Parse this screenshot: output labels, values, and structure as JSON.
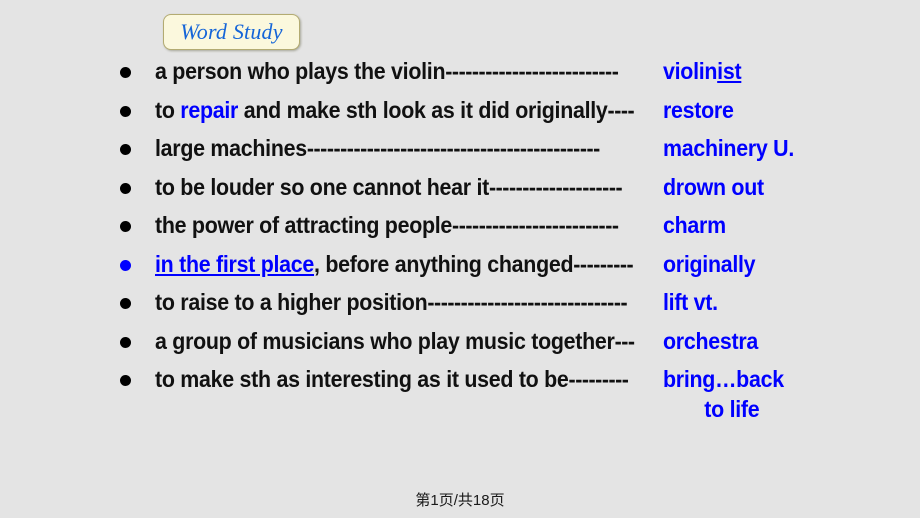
{
  "slide": {
    "background_color": "#e4e4e4",
    "title_chip": {
      "label": "Word Study",
      "text_color": "#1565d8",
      "fill_color": "#fbf8dd",
      "border_color": "#b3ab72"
    },
    "accent_color": "#0000ff",
    "rows": [
      {
        "bullet_color": "#000000",
        "clue_pre": "a person who plays the violin",
        "dashes": "--------------------------",
        "answer_main": "violin",
        "answer_underlined": "ist",
        "answer_second_line": ""
      },
      {
        "bullet_color": "#000000",
        "clue_pre": "to ",
        "clue_highlight": "repair",
        "clue_post": " and make sth look as it did originally",
        "dashes": "----",
        "answer_main": "restore",
        "answer_underlined": "",
        "answer_second_line": ""
      },
      {
        "bullet_color": "#000000",
        "clue_pre": "large machines",
        "dashes": "--------------------------------------------",
        "answer_main": "machinery U.",
        "answer_underlined": "",
        "answer_second_line": ""
      },
      {
        "bullet_color": "#000000",
        "clue_pre": "to be louder so one cannot hear it",
        "dashes": "--------------------",
        "answer_main": "drown out",
        "answer_underlined": "",
        "answer_second_line": ""
      },
      {
        "bullet_color": "#000000",
        "clue_pre": "the power of attracting people",
        "dashes": "-------------------------",
        "answer_main": "charm",
        "answer_underlined": "",
        "answer_second_line": ""
      },
      {
        "bullet_color": "#0000ff",
        "clue_highlight_underlined": "in the first place",
        "clue_post": ", before anything changed",
        "dashes": "---------",
        "answer_main": "originally",
        "answer_underlined": "",
        "answer_second_line": ""
      },
      {
        "bullet_color": "#000000",
        "clue_pre": "to raise to a higher position",
        "dashes": "------------------------------",
        "answer_main": "lift vt.",
        "answer_underlined": "",
        "answer_second_line": ""
      },
      {
        "bullet_color": "#000000",
        "clue_pre": "a group of musicians who play music together",
        "dashes": "---",
        "answer_main": "orchestra",
        "answer_underlined": "",
        "answer_second_line": ""
      },
      {
        "bullet_color": "#000000",
        "clue_pre": "to make sth as interesting as it used to be",
        "dashes": "---------",
        "answer_main": "bring…back",
        "answer_underlined": "",
        "answer_second_line": "to life"
      }
    ]
  },
  "footer": {
    "page_indicator": "第1页/共18页"
  }
}
